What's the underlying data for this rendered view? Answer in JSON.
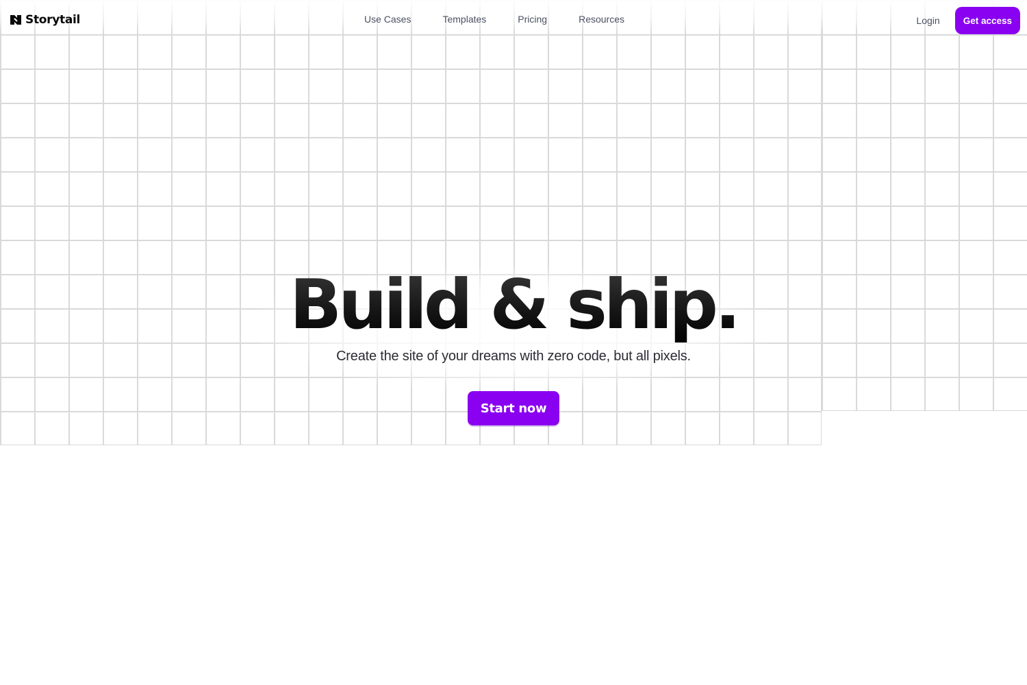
{
  "brand": {
    "name": "Storytail",
    "logo_icon": "storytail-logo-mark",
    "accent_color": "#8a00f0"
  },
  "nav": {
    "links": [
      {
        "label": "Use Cases"
      },
      {
        "label": "Templates"
      },
      {
        "label": "Pricing"
      },
      {
        "label": "Resources"
      }
    ],
    "login_label": "Login",
    "cta_label": "Get access"
  },
  "hero": {
    "title": "Build & ship.",
    "subtitle": "Create the site of your dreams with zero code, but all pixels.",
    "cta_label": "Start now"
  }
}
